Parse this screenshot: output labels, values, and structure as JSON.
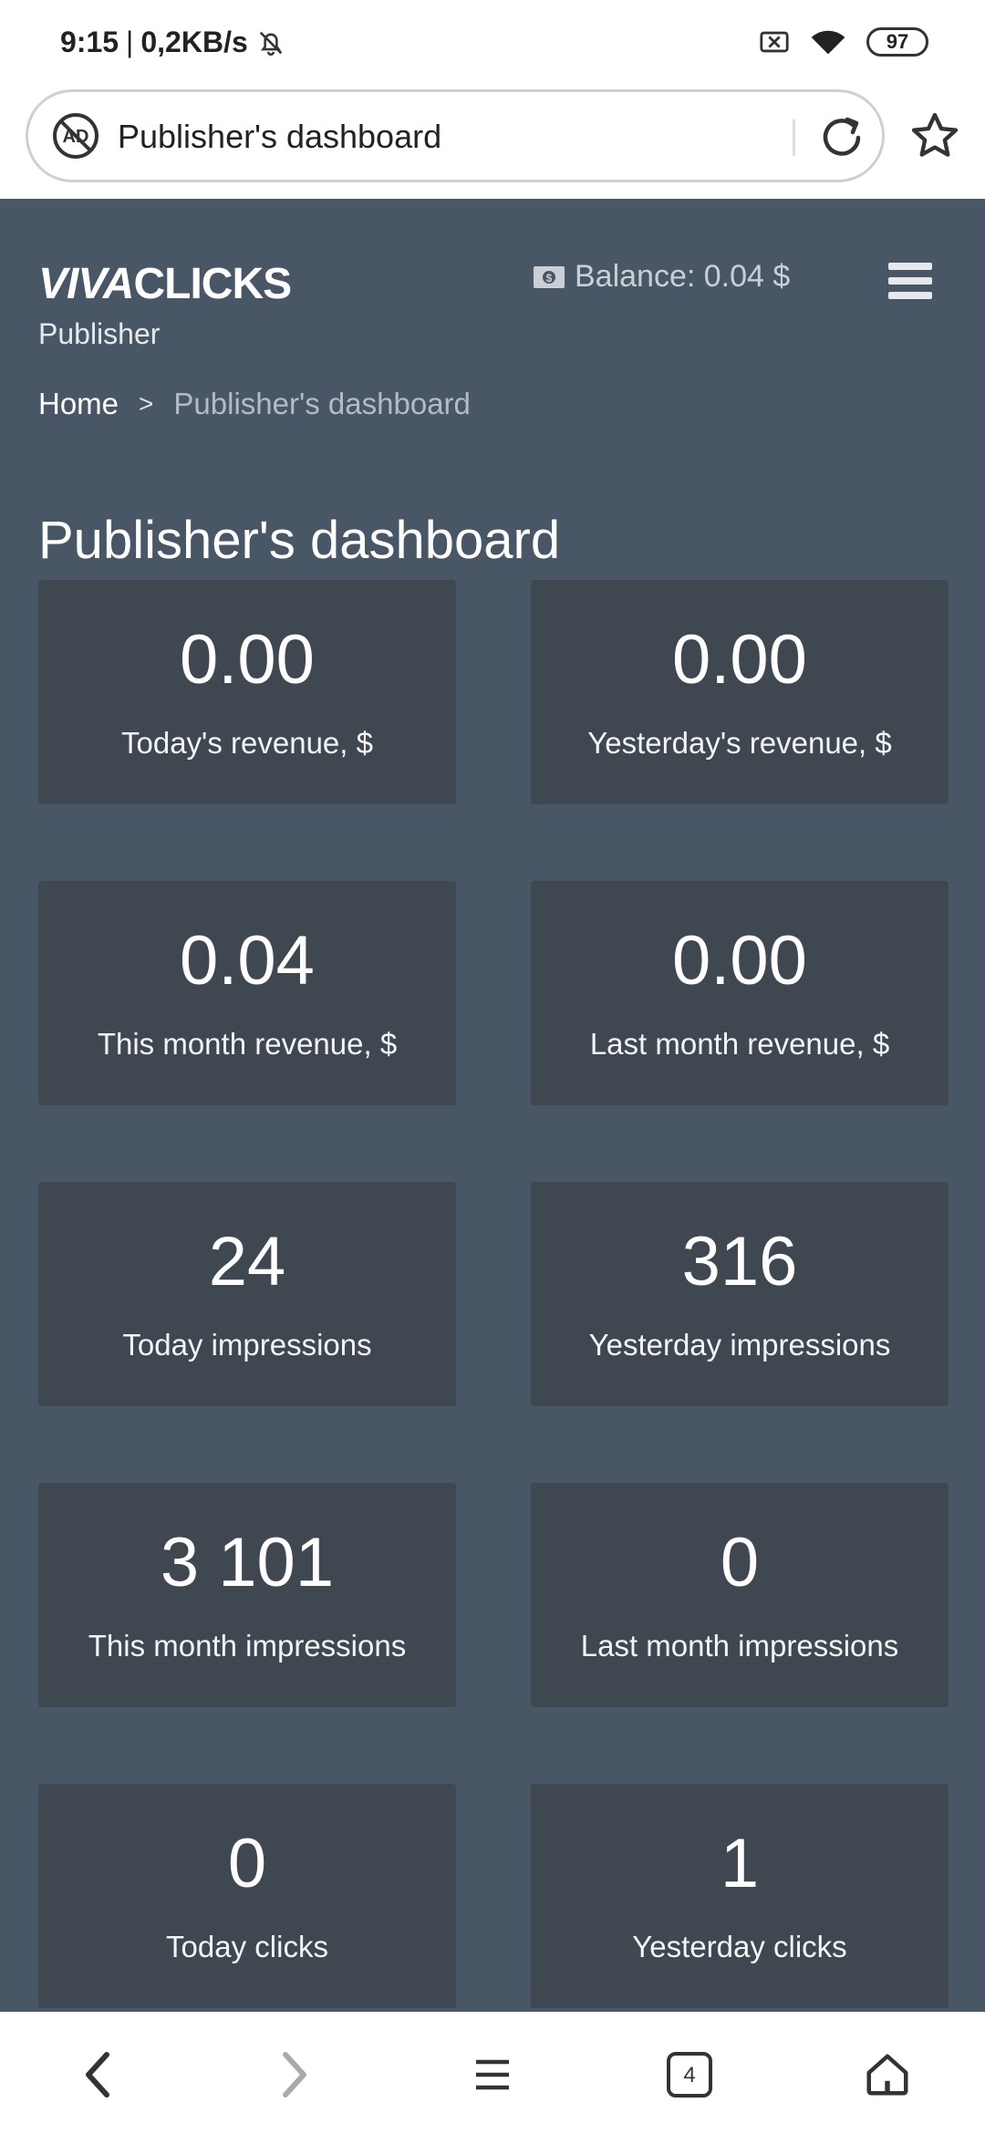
{
  "status_bar": {
    "time": "9:15",
    "separator": "|",
    "speed": "0,2KB/s",
    "battery": "97"
  },
  "browser": {
    "address_text": "Publisher's dashboard",
    "tabs_count": "4"
  },
  "header": {
    "logo_part1": "VIVA",
    "logo_part2": "CLICKS",
    "role": "Publisher",
    "balance": "Balance: 0.04 $"
  },
  "breadcrumb": {
    "home": "Home",
    "separator": ">",
    "current": "Publisher's dashboard"
  },
  "page_title": "Publisher's dashboard",
  "stats": [
    {
      "value": "0.00",
      "label": "Today's revenue, $"
    },
    {
      "value": "0.00",
      "label": "Yesterday's revenue, $"
    },
    {
      "value": "0.04",
      "label": "This month revenue, $"
    },
    {
      "value": "0.00",
      "label": "Last month revenue, $"
    },
    {
      "value": "24",
      "label": "Today impressions"
    },
    {
      "value": "316",
      "label": "Yesterday impressions"
    },
    {
      "value": "3 101",
      "label": "This month impressions"
    },
    {
      "value": "0",
      "label": "Last month impressions"
    },
    {
      "value": "0",
      "label": "Today clicks"
    },
    {
      "value": "1",
      "label": "Yesterday clicks"
    }
  ]
}
